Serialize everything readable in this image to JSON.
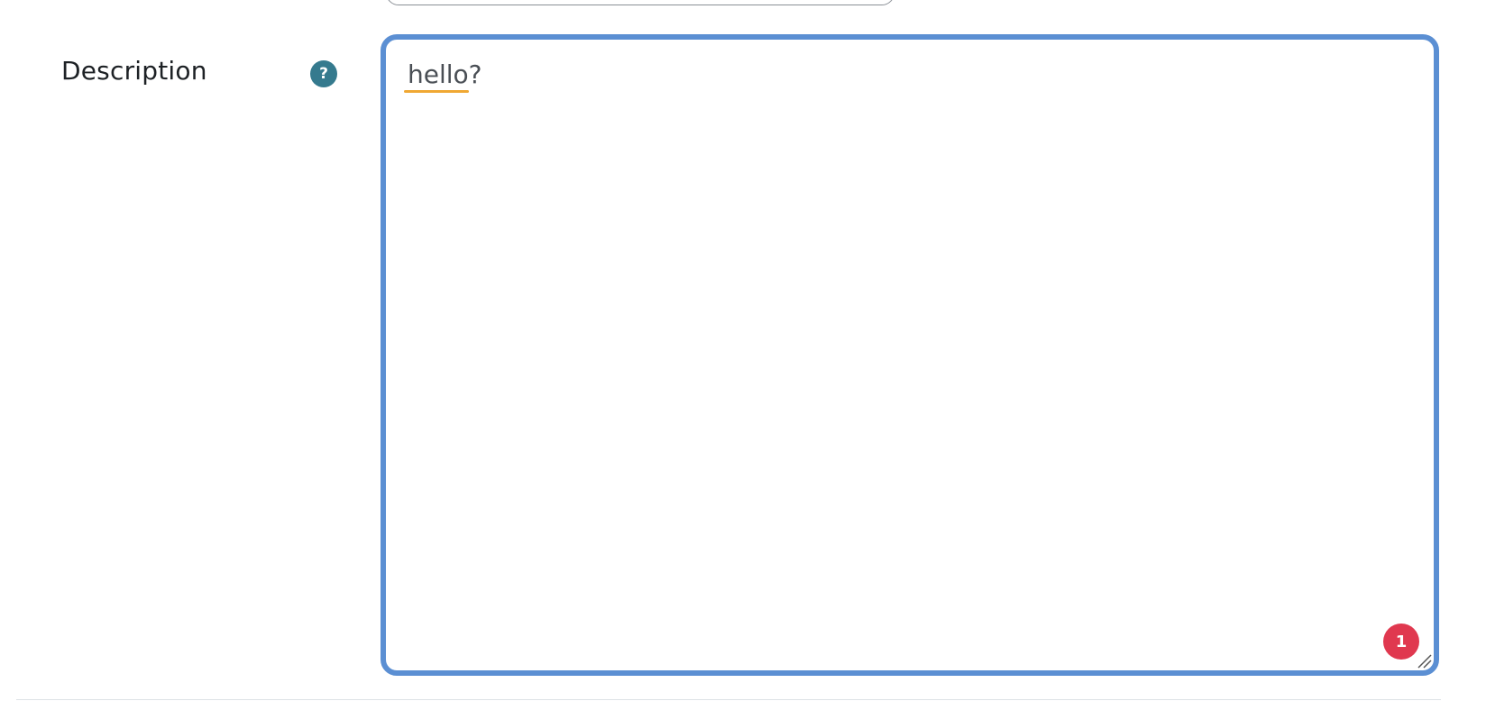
{
  "form": {
    "description_label": "Description",
    "help_icon_glyph": "?",
    "description_value": "hello?",
    "badge_count": "1"
  },
  "colors": {
    "focus_border": "#5b8fd3",
    "help_icon_bg": "#357a8e",
    "badge_bg": "#e0384f",
    "spellcheck_underline": "#f0a833"
  },
  "icons": {
    "help": "help-icon",
    "resize": "resize-handle-icon"
  }
}
